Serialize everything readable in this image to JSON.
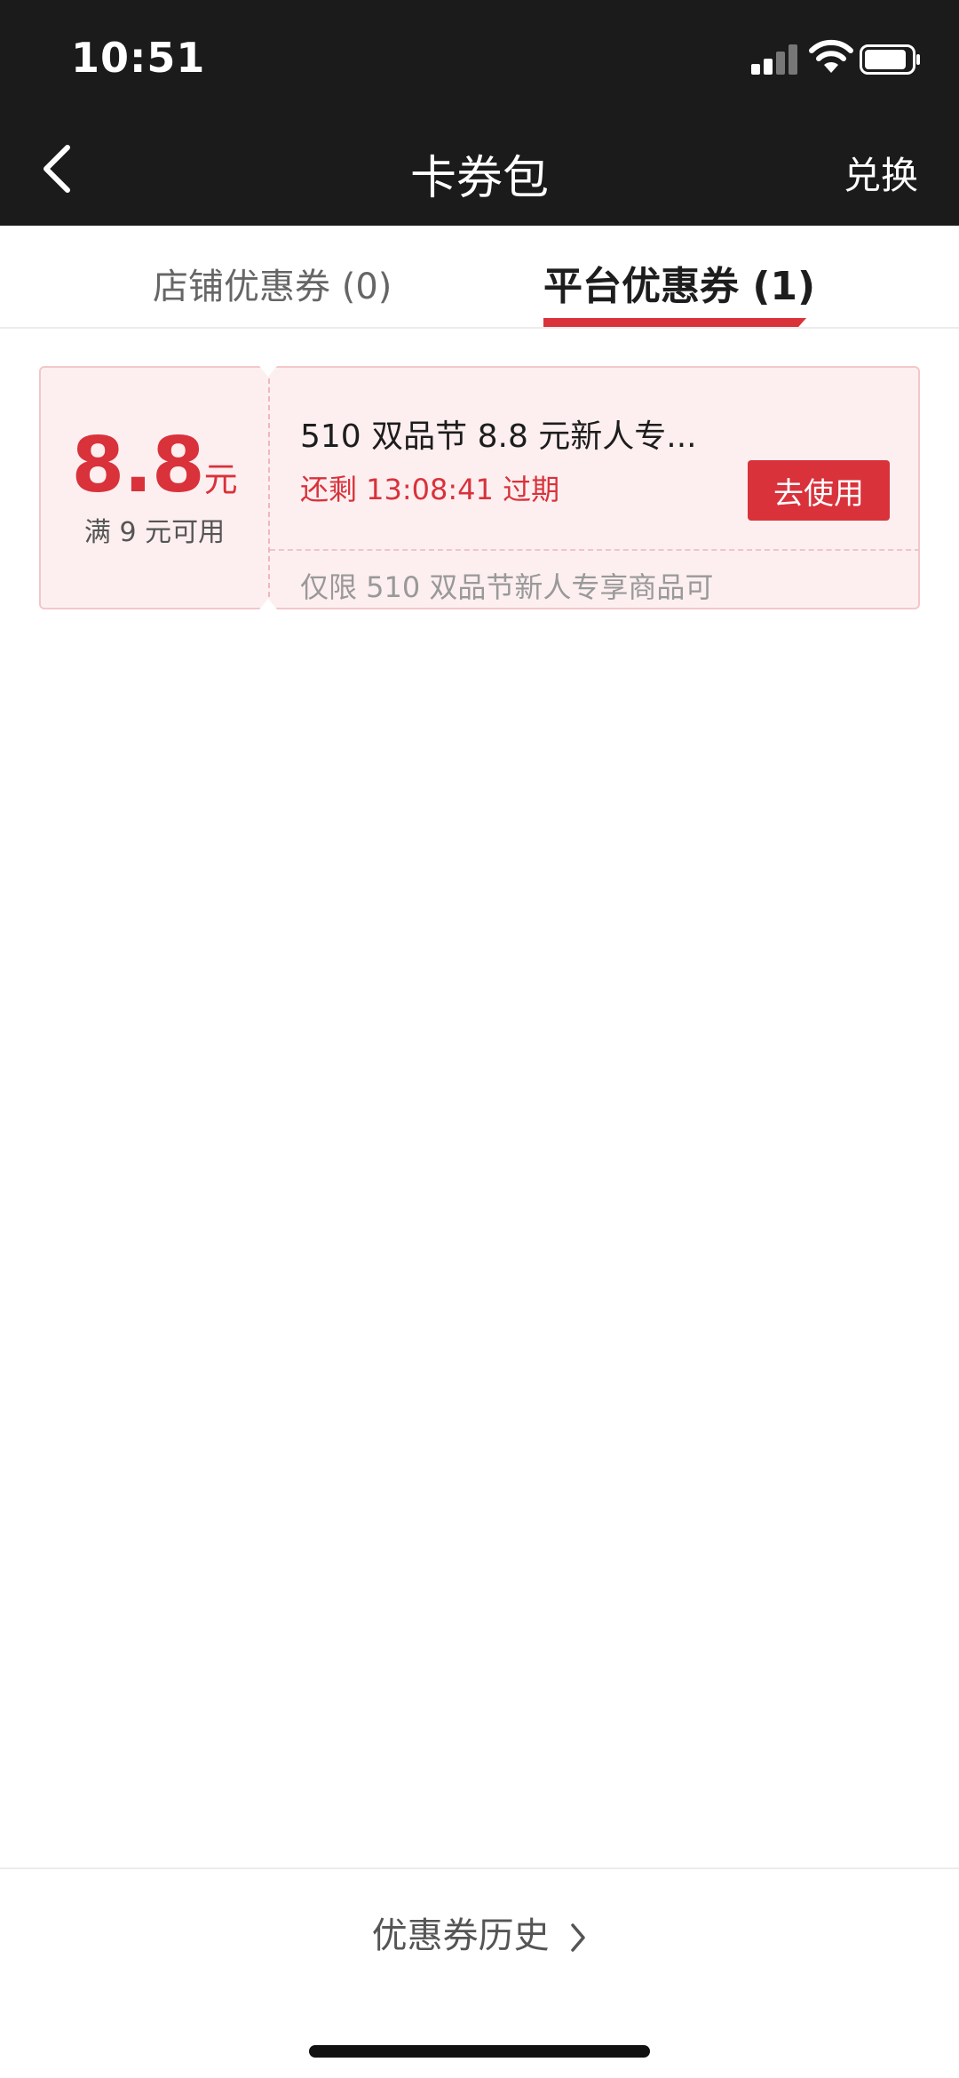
{
  "status_bar": {
    "time": "10:51"
  },
  "nav": {
    "title": "卡券包",
    "right_action": "兑换"
  },
  "tabs": [
    {
      "label": "店铺优惠券 (0)",
      "active": false
    },
    {
      "label": "平台优惠券 (1)",
      "active": true
    }
  ],
  "coupons": [
    {
      "amount": "8.8",
      "unit": "元",
      "condition": "满 9 元可用",
      "title": "510 双品节 8.8 元新人专...",
      "expiry": "还剩 13:08:41 过期",
      "button": "去使用",
      "scope": "仅限 510 双品节新人专享商品可"
    }
  ],
  "footer": {
    "history_label": "优惠券历史"
  },
  "colors": {
    "accent": "#d9323b",
    "header_bg": "#1b1b1b",
    "coupon_bg": "#fdeff0"
  }
}
